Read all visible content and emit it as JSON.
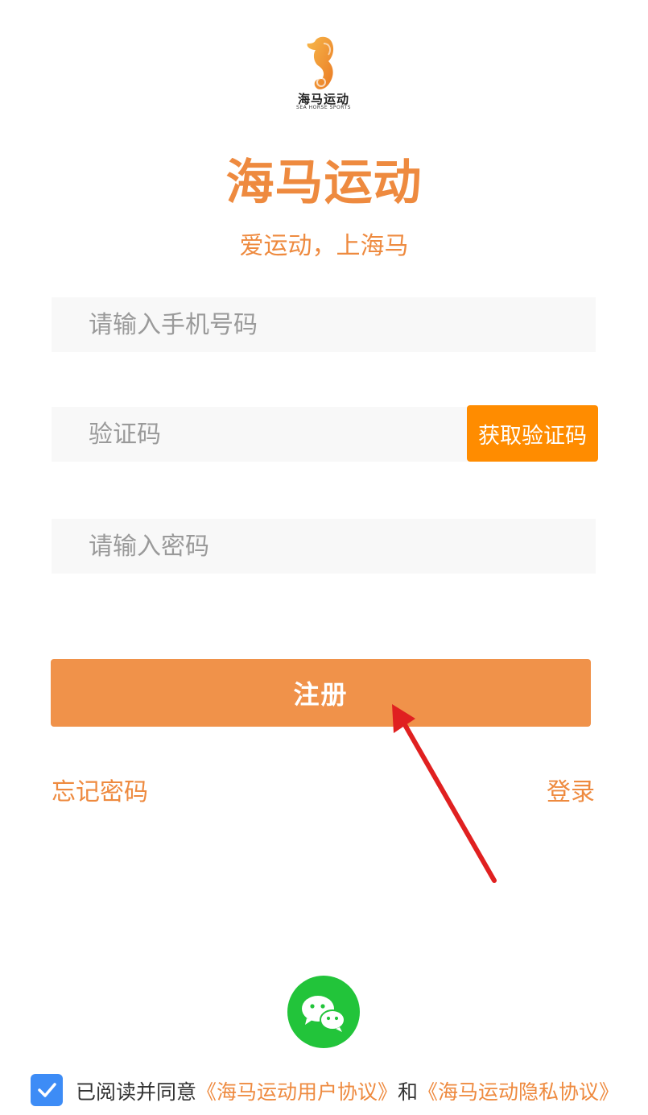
{
  "logo": {
    "icon": "seahorse-logo-icon",
    "brand_cn": "海马运动",
    "brand_en": "SEA HORSE SPORTS"
  },
  "app_title": "海马运动",
  "slogan": "爱运动，上海马",
  "form": {
    "phone_placeholder": "请输入手机号码",
    "code_placeholder": "验证码",
    "get_code_label": "获取验证码",
    "password_placeholder": "请输入密码",
    "register_label": "注册"
  },
  "links": {
    "forgot_password": "忘记密码",
    "login": "登录"
  },
  "social": {
    "wechat_icon": "wechat-icon"
  },
  "agreement": {
    "checked": true,
    "prefix": "已阅读并同意",
    "user_agreement": "《海马运动用户协议》",
    "conjunction": "和",
    "privacy_agreement": "《海马运动隐私协议》"
  },
  "colors": {
    "accent": "#ee8a3f",
    "code_button": "#ff8c00",
    "register_button": "#f0924a",
    "wechat": "#22c43a",
    "checkbox": "#3d8cf6",
    "annotation_arrow": "#e02020"
  }
}
